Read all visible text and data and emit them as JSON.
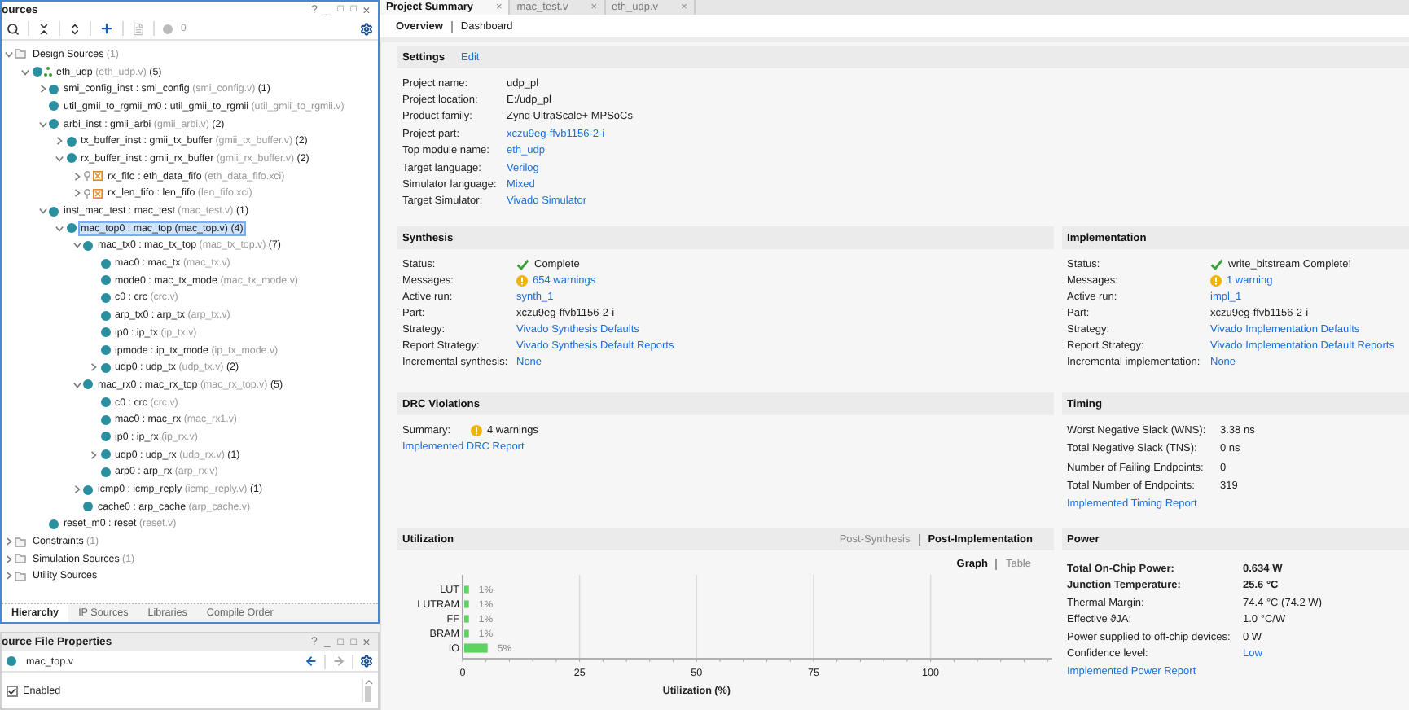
{
  "sources": {
    "title": "ources",
    "window_controls": [
      {
        "kind": "help",
        "glyph": "?"
      },
      {
        "kind": "minimize",
        "glyph": "_"
      },
      {
        "kind": "restore",
        "glyph": "□"
      },
      {
        "kind": "maximize",
        "glyph": "□"
      },
      {
        "kind": "close",
        "glyph": "×"
      }
    ],
    "toolbar_count": "0",
    "tree": [
      {
        "kind": "folder",
        "name": "Design Sources",
        "count": "(1)",
        "expanded": true,
        "selected": false,
        "children": [
          {
            "kind": "top",
            "name": "eth_udp",
            "file": "(eth_udp.v)",
            "count": "(5)",
            "expanded": true,
            "selected": false,
            "children": [
              {
                "kind": "module",
                "name": "smi_config_inst : smi_config",
                "file": "(smi_config.v)",
                "count": "(1)",
                "expanded": false,
                "selected": false
              },
              {
                "kind": "module",
                "name": "util_gmii_to_rgmii_m0 : util_gmii_to_rgmii",
                "file": "(util_gmii_to_rgmii.v)",
                "selected": false
              },
              {
                "kind": "module",
                "name": "arbi_inst : gmii_arbi",
                "file": "(gmii_arbi.v)",
                "count": "(2)",
                "expanded": true,
                "selected": false,
                "children": [
                  {
                    "kind": "module",
                    "name": "tx_buffer_inst : gmii_tx_buffer",
                    "file": "(gmii_tx_buffer.v)",
                    "count": "(2)",
                    "expanded": false,
                    "selected": false
                  },
                  {
                    "kind": "module",
                    "name": "rx_buffer_inst : gmii_rx_buffer",
                    "file": "(gmii_rx_buffer.v)",
                    "count": "(2)",
                    "expanded": true,
                    "selected": false,
                    "children": [
                      {
                        "kind": "ip",
                        "name": "rx_fifo : eth_data_fifo",
                        "file": "(eth_data_fifo.xci)",
                        "expanded": false,
                        "selected": false
                      },
                      {
                        "kind": "ip",
                        "name": "rx_len_fifo : len_fifo",
                        "file": "(len_fifo.xci)",
                        "expanded": false,
                        "selected": false
                      }
                    ]
                  }
                ]
              },
              {
                "kind": "module",
                "name": "inst_mac_test : mac_test",
                "file": "(mac_test.v)",
                "count": "(1)",
                "expanded": true,
                "selected": false,
                "children": [
                  {
                    "kind": "module",
                    "name": "mac_top0 : mac_top",
                    "file": "(mac_top.v)",
                    "count": "(4)",
                    "expanded": true,
                    "selected": true,
                    "children": [
                      {
                        "kind": "module",
                        "name": "mac_tx0 : mac_tx_top",
                        "file": "(mac_tx_top.v)",
                        "count": "(7)",
                        "expanded": true,
                        "selected": false,
                        "children": [
                          {
                            "kind": "module",
                            "name": "mac0 : mac_tx",
                            "file": "(mac_tx.v)",
                            "selected": false
                          },
                          {
                            "kind": "module",
                            "name": "mode0 : mac_tx_mode",
                            "file": "(mac_tx_mode.v)",
                            "selected": false
                          },
                          {
                            "kind": "module",
                            "name": "c0 : crc",
                            "file": "(crc.v)",
                            "selected": false
                          },
                          {
                            "kind": "module",
                            "name": "arp_tx0 : arp_tx",
                            "file": "(arp_tx.v)",
                            "selected": false
                          },
                          {
                            "kind": "module",
                            "name": "ip0 : ip_tx",
                            "file": "(ip_tx.v)",
                            "selected": false
                          },
                          {
                            "kind": "module",
                            "name": "ipmode : ip_tx_mode",
                            "file": "(ip_tx_mode.v)",
                            "selected": false
                          },
                          {
                            "kind": "module",
                            "name": "udp0 : udp_tx",
                            "file": "(udp_tx.v)",
                            "count": "(2)",
                            "expanded": false,
                            "selected": false
                          }
                        ]
                      },
                      {
                        "kind": "module",
                        "name": "mac_rx0 : mac_rx_top",
                        "file": "(mac_rx_top.v)",
                        "count": "(5)",
                        "expanded": true,
                        "selected": false,
                        "children": [
                          {
                            "kind": "module",
                            "name": "c0 : crc",
                            "file": "(crc.v)",
                            "selected": false
                          },
                          {
                            "kind": "module",
                            "name": "mac0 : mac_rx",
                            "file": "(mac_rx1.v)",
                            "selected": false
                          },
                          {
                            "kind": "module",
                            "name": "ip0 : ip_rx",
                            "file": "(ip_rx.v)",
                            "selected": false
                          },
                          {
                            "kind": "module",
                            "name": "udp0 : udp_rx",
                            "file": "(udp_rx.v)",
                            "count": "(1)",
                            "expanded": false,
                            "selected": false
                          },
                          {
                            "kind": "module",
                            "name": "arp0 : arp_rx",
                            "file": "(arp_rx.v)",
                            "selected": false
                          }
                        ]
                      },
                      {
                        "kind": "module",
                        "name": "icmp0 : icmp_reply",
                        "file": "(icmp_reply.v)",
                        "count": "(1)",
                        "expanded": false,
                        "selected": false
                      },
                      {
                        "kind": "module",
                        "name": "cache0 : arp_cache",
                        "file": "(arp_cache.v)",
                        "selected": false
                      }
                    ]
                  }
                ]
              },
              {
                "kind": "module",
                "name": "reset_m0 : reset",
                "file": "(reset.v)",
                "selected": false
              }
            ]
          }
        ]
      },
      {
        "kind": "folder",
        "name": "Constraints",
        "count": "(1)",
        "expanded": false,
        "selected": false
      },
      {
        "kind": "folder",
        "name": "Simulation Sources",
        "count": "(1)",
        "expanded": false,
        "selected": false
      },
      {
        "kind": "folder",
        "name": "Utility Sources",
        "expanded": false,
        "selected": false
      }
    ],
    "tabs": [
      {
        "label": "Hierarchy",
        "selected": true
      },
      {
        "label": "IP Sources",
        "selected": false
      },
      {
        "label": "Libraries",
        "selected": false
      },
      {
        "label": "Compile Order",
        "selected": false
      }
    ]
  },
  "properties": {
    "title": "ource File Properties",
    "window_controls": [
      {
        "kind": "help",
        "glyph": "?"
      },
      {
        "kind": "minimize",
        "glyph": "_"
      },
      {
        "kind": "restore",
        "glyph": "□"
      },
      {
        "kind": "maximize",
        "glyph": "□"
      },
      {
        "kind": "close",
        "glyph": "×"
      }
    ],
    "file": "mac_top.v",
    "enabled_label": "Enabled",
    "enabled": true
  },
  "editor_tabs": [
    {
      "label": "Project Summary",
      "close": "×",
      "selected": true
    },
    {
      "label": "mac_test.v",
      "close": "×",
      "selected": false
    },
    {
      "label": "eth_udp.v",
      "close": "×",
      "selected": false
    }
  ],
  "view_tabs": [
    {
      "label": "Overview",
      "selected": true
    },
    {
      "label": "Dashboard",
      "selected": false
    }
  ],
  "settings": {
    "title": "Settings",
    "edit": "Edit",
    "rows": [
      {
        "label": "Project name:",
        "value": "udp_pl",
        "kind": "text"
      },
      {
        "label": "Project location:",
        "value": "E:/udp_pl",
        "kind": "text"
      },
      {
        "label": "Product family:",
        "value": "Zynq UltraScale+ MPSoCs",
        "kind": "text"
      },
      {
        "label": "Project part:",
        "value": "xczu9eg-ffvb1156-2-i",
        "kind": "link"
      },
      {
        "label": "Top module name:",
        "value": "eth_udp",
        "kind": "link"
      },
      {
        "label": "Target language:",
        "value": "Verilog",
        "kind": "link"
      },
      {
        "label": "Simulator language:",
        "value": "Mixed",
        "kind": "link"
      },
      {
        "label": "Target Simulator:",
        "value": "Vivado Simulator",
        "kind": "link"
      }
    ]
  },
  "synthesis": {
    "title": "Synthesis",
    "rows": [
      {
        "label": "Status:",
        "value": "Complete",
        "kind": "ok"
      },
      {
        "label": "Messages:",
        "value": "654 warnings",
        "kind": "warning-link"
      },
      {
        "label": "Active run:",
        "value": "synth_1",
        "kind": "link"
      },
      {
        "label": "Part:",
        "value": "xczu9eg-ffvb1156-2-i",
        "kind": "text"
      },
      {
        "label": "Strategy:",
        "value": "Vivado Synthesis Defaults",
        "kind": "link"
      },
      {
        "label": "Report Strategy:",
        "value": "Vivado Synthesis Default Reports",
        "kind": "link"
      },
      {
        "label": "Incremental synthesis:",
        "value": "None",
        "kind": "link"
      }
    ]
  },
  "implementation": {
    "title": "Implementation",
    "rows": [
      {
        "label": "Status:",
        "value": "write_bitstream Complete!",
        "kind": "ok"
      },
      {
        "label": "Messages:",
        "value": "1 warning",
        "kind": "warning-link"
      },
      {
        "label": "Active run:",
        "value": "impl_1",
        "kind": "link"
      },
      {
        "label": "Part:",
        "value": "xczu9eg-ffvb1156-2-i",
        "kind": "text"
      },
      {
        "label": "Strategy:",
        "value": "Vivado Implementation Defaults",
        "kind": "link"
      },
      {
        "label": "Report Strategy:",
        "value": "Vivado Implementation Default Reports",
        "kind": "link"
      },
      {
        "label": "Incremental implementation:",
        "value": "None",
        "kind": "link"
      }
    ]
  },
  "drc": {
    "title": "DRC Violations",
    "rows": [
      {
        "label": "Summary:",
        "value": "4 warnings",
        "kind": "warning"
      }
    ],
    "report": "Implemented DRC Report"
  },
  "timing": {
    "title": "Timing",
    "rows": [
      {
        "label": "Worst Negative Slack (WNS):",
        "value": "3.38 ns",
        "kind": "text"
      },
      {
        "label": "Total Negative Slack (TNS):",
        "value": "0 ns",
        "kind": "text"
      },
      {
        "label": "Number of Failing Endpoints:",
        "value": "0",
        "kind": "text"
      },
      {
        "label": "Total Number of Endpoints:",
        "value": "319",
        "kind": "text"
      }
    ],
    "report": "Implemented Timing Report"
  },
  "utilization": {
    "title": "Utilization",
    "stages": [
      {
        "label": "Post-Synthesis",
        "selected": false
      },
      {
        "label": "Post-Implementation",
        "selected": true
      }
    ],
    "views": [
      {
        "label": "Graph",
        "selected": true
      },
      {
        "label": "Table",
        "selected": false
      }
    ],
    "chart_data": {
      "type": "bar",
      "orientation": "horizontal",
      "xlabel": "Utilization (%)",
      "categories": [
        "LUT",
        "LUTRAM",
        "FF",
        "BRAM",
        "IO"
      ],
      "series": [
        {
          "color": "#5fd35f",
          "values": [
            1,
            1,
            1,
            1,
            5
          ]
        }
      ],
      "grid": true,
      "value_labels": [
        "1%",
        "1%",
        "1%",
        "1%",
        "5%"
      ],
      "xlim": [
        0,
        126
      ],
      "xticks": [
        0,
        25,
        50,
        75,
        100
      ]
    }
  },
  "power": {
    "title": "Power",
    "rows": [
      {
        "label": "Total On-Chip Power:",
        "value": "0.634 W",
        "kind": "text",
        "emphasis": true
      },
      {
        "label": "Junction Temperature:",
        "value": "25.6 °C",
        "kind": "text",
        "emphasis": true
      },
      {
        "label": "Thermal Margin:",
        "value": "74.4 °C (74.2 W)",
        "kind": "text",
        "emphasis": false
      },
      {
        "label": "Effective ϑJA:",
        "value": "1.0 °C/W",
        "kind": "text",
        "emphasis": false
      },
      {
        "label": "Power supplied to off-chip devices:",
        "value": "0 W",
        "kind": "text",
        "emphasis": false
      },
      {
        "label": "Confidence level:",
        "value": "Low",
        "kind": "link",
        "emphasis": false
      }
    ],
    "report": "Implemented Power Report"
  }
}
